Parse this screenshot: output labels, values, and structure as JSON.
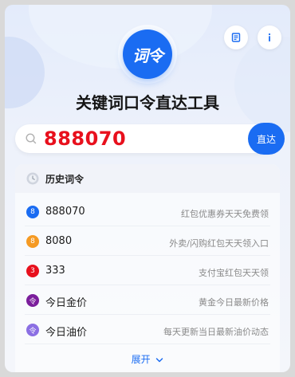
{
  "logo": {
    "text": "词令"
  },
  "header": {
    "title": "关键词口令直达工具"
  },
  "search": {
    "value": "888070",
    "button_label": "直达"
  },
  "history": {
    "title": "历史词令",
    "items": [
      {
        "badge": "8",
        "badge_color": "#1a6cf2",
        "code": "888070",
        "desc": "红包优惠券天天免费领"
      },
      {
        "badge": "8",
        "badge_color": "#f59a23",
        "code": "8080",
        "desc": "外卖/闪购红包天天领入口"
      },
      {
        "badge": "3",
        "badge_color": "#e8101d",
        "code": "333",
        "desc": "支付宝红包天天领"
      },
      {
        "badge": "令",
        "badge_color": "#7b1e9c",
        "code": "今日金价",
        "desc": "黄金今日最新价格"
      },
      {
        "badge": "令",
        "badge_color": "#8b6fe3",
        "code": "今日油价",
        "desc": "每天更新当日最新油价动态"
      }
    ],
    "expand_label": "展开"
  },
  "icons": {
    "top_left_button": "document-icon",
    "top_right_button": "info-icon",
    "search": "search-icon",
    "history": "clock-icon",
    "expand": "chevron-down-icon"
  }
}
